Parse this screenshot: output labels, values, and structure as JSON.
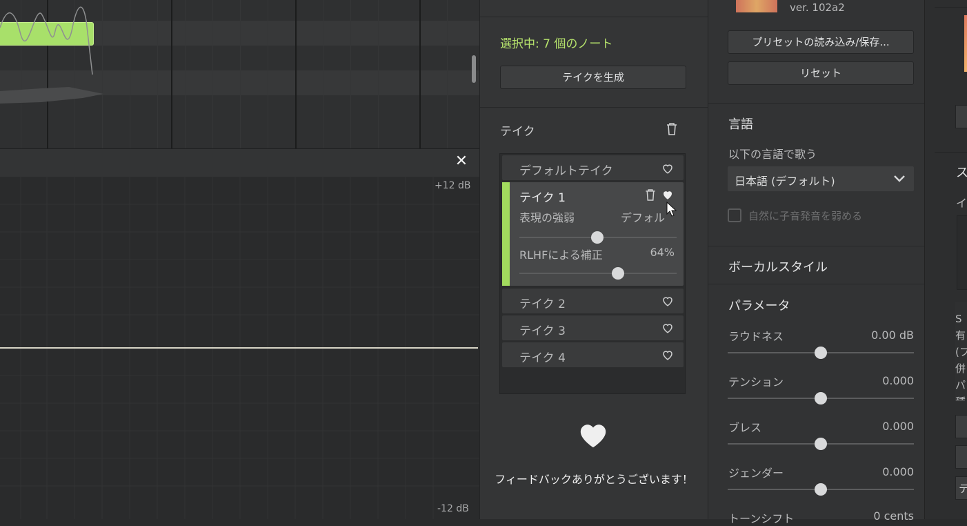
{
  "piano_roll": {
    "db_top": "+12 dB",
    "db_bottom": "-12 dB"
  },
  "takes": {
    "selection_text": "選択中: 7 個のノート",
    "generate_button": "テイクを生成",
    "heading": "テイク",
    "default_take": "デフォルトテイク",
    "take1": {
      "label": "テイク 1",
      "expression_label": "表現の強弱",
      "expression_value": "デフォルト",
      "rlhf_label": "RLHFによる補正",
      "rlhf_value": "64%"
    },
    "others": [
      "テイク 2",
      "テイク 3",
      "テイク 4"
    ],
    "thanks": "フィードバックありがとうございます！"
  },
  "voice": {
    "version": "ver. 102a2",
    "preset_button": "プリセットの読み込み/保存...",
    "reset_button": "リセット",
    "language_title": "言語",
    "sing_in_label": "以下の言語で歌う",
    "language_value": "日本語 (デフォルト)",
    "weaken_consonant_label": "自然に子音発音を弱める",
    "vocal_style_title": "ボーカルスタイル",
    "parameters_title": "パラメータ",
    "params": [
      {
        "label": "ラウドネス",
        "value": "0.00 dB"
      },
      {
        "label": "テンション",
        "value": "0.000"
      },
      {
        "label": "ブレス",
        "value": "0.000"
      },
      {
        "label": "ジェンダー",
        "value": "0.000"
      },
      {
        "label": "トーンシフト",
        "value": "0 cents"
      }
    ]
  },
  "right_strip": {
    "texts": [
      "ス",
      "イ",
      "S",
      "有",
      "(フ",
      "併",
      "パ",
      "種",
      "テ"
    ]
  },
  "colors": {
    "accent_green": "#a2db5e",
    "note_green": "#a8e06a",
    "selection_text": "#b6e36c"
  }
}
